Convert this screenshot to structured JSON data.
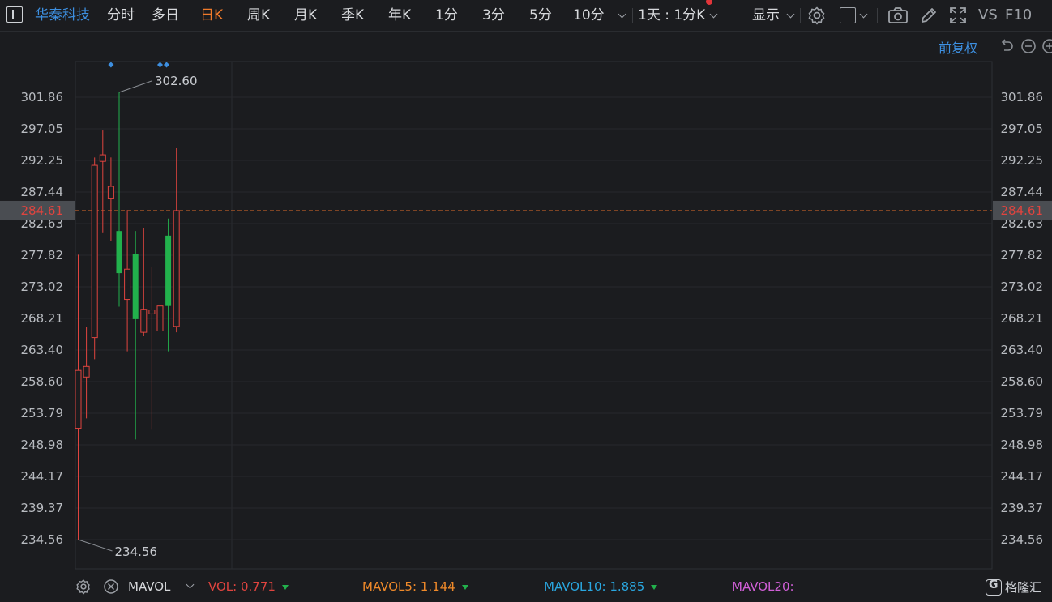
{
  "toolbar": {
    "stock_name": "华秦科技",
    "periods": [
      "分时",
      "多日",
      "日K",
      "周K",
      "月K",
      "季K",
      "年K",
      "1分",
      "3分",
      "5分",
      "10分"
    ],
    "active_period": "日K",
    "multi_period": "1天 : 1分K",
    "display_label": "显示",
    "vs_label": "VS",
    "f10_label": "F10"
  },
  "chart": {
    "restore_label": "前复权",
    "y_ticks": [
      "301.86",
      "297.05",
      "292.25",
      "287.44",
      "282.63",
      "277.82",
      "273.02",
      "268.21",
      "263.40",
      "258.60",
      "253.79",
      "248.98",
      "244.17",
      "239.37",
      "234.56"
    ],
    "current_price": "284.61",
    "high_label": "302.60",
    "low_label": "234.56"
  },
  "volume_bar": {
    "indicator_name": "MAVOL",
    "vol_label": "VOL:",
    "vol_value": "0.771",
    "mavol5_label": "MAVOL5:",
    "mavol5_value": "1.144",
    "mavol10_label": "MAVOL10:",
    "mavol10_value": "1.885",
    "mavol20_label": "MAVOL20:"
  },
  "colors": {
    "up": "#e0443f",
    "down": "#22b14c",
    "accent": "#3d8fe0",
    "active_tab": "#f07a2a",
    "current_line": "#e06b2a",
    "mavol5": "#f08a2a",
    "mavol10": "#2aa7e0",
    "mavol20": "#d25fd8"
  },
  "chart_data": {
    "type": "candlestick",
    "y_axis_ticks": [
      301.86,
      297.05,
      292.25,
      287.44,
      282.63,
      277.82,
      273.02,
      268.21,
      263.4,
      258.6,
      253.79,
      248.98,
      244.17,
      239.37,
      234.56
    ],
    "current_price": 284.61,
    "high": 302.6,
    "low": 234.56,
    "candles": [
      {
        "open": 251.5,
        "close": 260.3,
        "high": 277.9,
        "low": 234.56
      },
      {
        "open": 259.3,
        "close": 260.9,
        "high": 266.9,
        "low": 253.0
      },
      {
        "open": 265.3,
        "close": 291.5,
        "high": 292.7,
        "low": 262.0
      },
      {
        "open": 292.1,
        "close": 293.1,
        "high": 296.8,
        "low": 281.3
      },
      {
        "open": 286.5,
        "close": 288.3,
        "high": 292.7,
        "low": 280.0
      },
      {
        "open": 281.5,
        "close": 275.1,
        "high": 302.6,
        "low": 270.0
      },
      {
        "open": 271.1,
        "close": 275.7,
        "high": 284.7,
        "low": 263.2
      },
      {
        "open": 278.0,
        "close": 268.1,
        "high": 281.5,
        "low": 249.8
      },
      {
        "open": 266.1,
        "close": 269.6,
        "high": 282.0,
        "low": 265.5
      },
      {
        "open": 268.9,
        "close": 269.5,
        "high": 276.1,
        "low": 251.3
      },
      {
        "open": 266.3,
        "close": 270.1,
        "high": 275.7,
        "low": 256.8
      },
      {
        "open": 280.8,
        "close": 270.1,
        "high": 283.4,
        "low": 263.2
      },
      {
        "open": 267.0,
        "close": 284.61,
        "high": 294.1,
        "low": 266.1
      }
    ]
  }
}
